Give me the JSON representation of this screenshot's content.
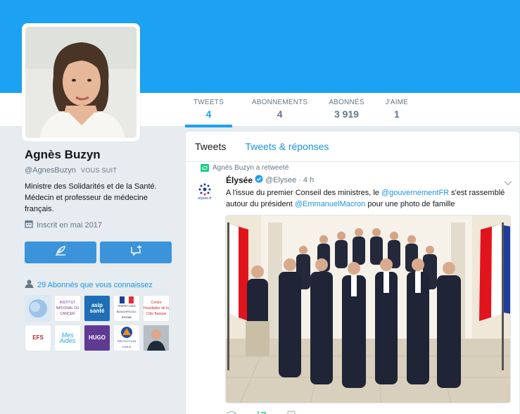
{
  "profile": {
    "name": "Agnès Buzyn",
    "handle": "@AgnesBuzyn",
    "follows_you": "VOUS SUIT",
    "bio_line1": "Ministre des Solidarités et de la Santé.",
    "bio_line2": "Médecin et professeur de médecine",
    "bio_line3": "français.",
    "joined": "Inscrit en mai 2017"
  },
  "stats": [
    {
      "label": "TWEETS",
      "value": "4"
    },
    {
      "label": "ABONNEMENTS",
      "value": "4"
    },
    {
      "label": "ABONNÉS",
      "value": "3 919"
    },
    {
      "label": "J'AIME",
      "value": "1"
    }
  ],
  "mutual": {
    "text": "29 Abonnés que vous connaissez",
    "thumbs": [
      "",
      "INSTITUT NATIONAL DU CANCER",
      "asip santé",
      "PRÉFET DES BOUCHES-DU-RHÔNE",
      "Centre Hospitalier de la Côte Basque",
      "EFS",
      "Mes Aides",
      "HUGO",
      "PROTECTION CIVILE",
      ""
    ]
  },
  "timeline": {
    "tab_tweets": "Tweets",
    "tab_replies": "Tweets & réponses"
  },
  "tweet": {
    "retweet_by": "Agnès Buzyn a retweeté",
    "author_name": "Élysée",
    "author_handle": "@Elysee",
    "dot": "·",
    "time": "4 h",
    "avatar_text": "elysee.fr",
    "text_part1": "A l'issue du premier Conseil des ministres, le ",
    "mention1": "@gouvernementFR",
    "text_part2": " s'est rassemblé autour du président ",
    "mention2": "@EmmanuelMacron",
    "text_part3": " pour une photo de famille"
  },
  "colors": {
    "brand": "#1da1f2",
    "button": "#3b94d9",
    "link": "#1b95e0"
  }
}
